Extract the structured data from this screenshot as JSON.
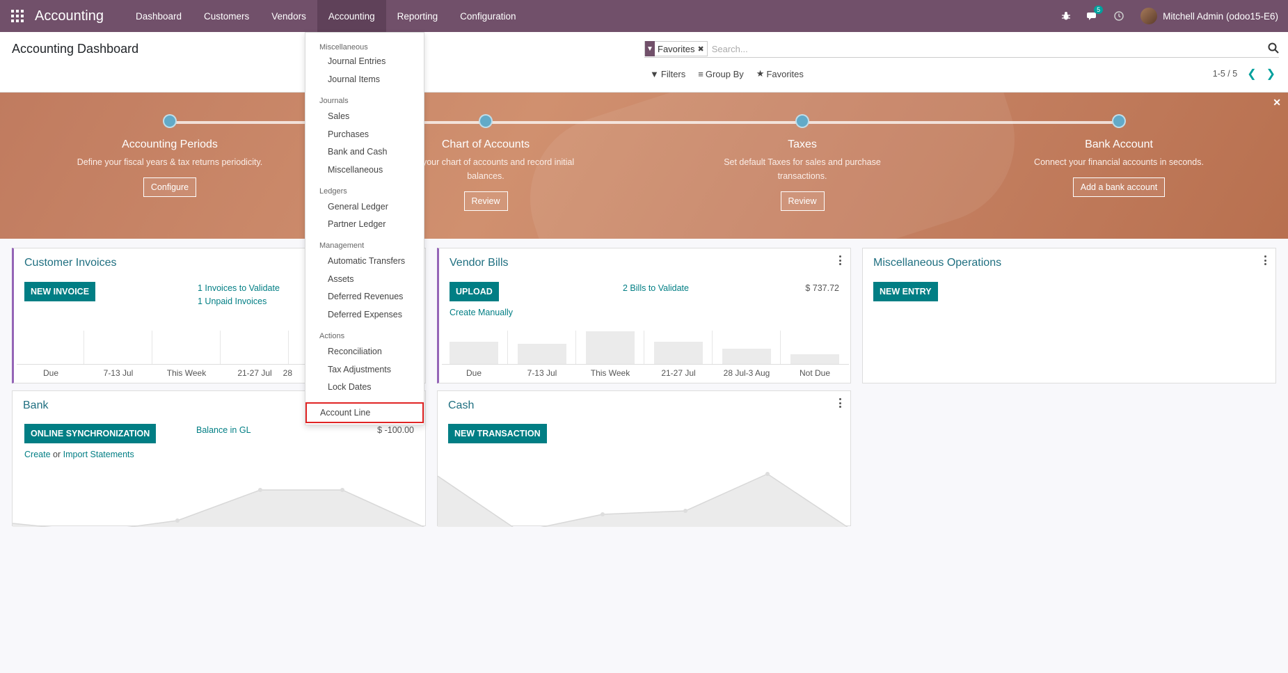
{
  "navbar": {
    "brand": "Accounting",
    "menu": [
      "Dashboard",
      "Customers",
      "Vendors",
      "Accounting",
      "Reporting",
      "Configuration"
    ],
    "messages_count": "5",
    "user": "Mitchell Admin (odoo15-E6)"
  },
  "control_panel": {
    "title": "Accounting Dashboard",
    "facet": "Favorites",
    "search_placeholder": "Search...",
    "filters": "Filters",
    "group_by": "Group By",
    "favorites": "Favorites",
    "pager": "1-5 / 5"
  },
  "banner": {
    "steps": [
      {
        "title": "Accounting Periods",
        "desc": "Define your fiscal years & tax returns periodicity.",
        "button": "Configure"
      },
      {
        "title": "Chart of Accounts",
        "desc": "Setup your chart of accounts and record initial balances.",
        "button": "Review"
      },
      {
        "title": "Taxes",
        "desc": "Set default Taxes for sales and purchase transactions.",
        "button": "Review"
      },
      {
        "title": "Bank Account",
        "desc": "Connect your financial accounts in seconds.",
        "button": "Add a bank account"
      }
    ]
  },
  "cards": {
    "customer_invoices": {
      "title": "Customer Invoices",
      "button": "NEW INVOICE",
      "link1": "1 Invoices to Validate",
      "link2": "1 Unpaid Invoices",
      "axis": [
        "Due",
        "7-13 Jul",
        "This Week",
        "21-27 Jul",
        "28"
      ]
    },
    "vendor_bills": {
      "title": "Vendor Bills",
      "button": "UPLOAD",
      "link1": "2 Bills to Validate",
      "amount": "$ 737.72",
      "link2": "Create Manually",
      "axis": [
        "Due",
        "7-13 Jul",
        "This Week",
        "21-27 Jul",
        "28 Jul-3 Aug",
        "Not Due"
      ]
    },
    "misc_operations": {
      "title": "Miscellaneous Operations",
      "button": "NEW ENTRY"
    },
    "bank": {
      "title": "Bank",
      "button": "ONLINE SYNCHRONIZATION",
      "link1": "Balance in GL",
      "amount": "$ -100.00",
      "create_link": "Create",
      "or_text": "or",
      "import_link": "Import Statements"
    },
    "cash": {
      "title": "Cash",
      "button": "NEW TRANSACTION"
    }
  },
  "dropdown": {
    "sections": [
      {
        "header": "Miscellaneous",
        "items": [
          "Journal Entries",
          "Journal Items"
        ]
      },
      {
        "header": "Journals",
        "items": [
          "Sales",
          "Purchases",
          "Bank and Cash",
          "Miscellaneous"
        ]
      },
      {
        "header": "Ledgers",
        "items": [
          "General Ledger",
          "Partner Ledger"
        ]
      },
      {
        "header": "Management",
        "items": [
          "Automatic Transfers",
          "Assets",
          "Deferred Revenues",
          "Deferred Expenses"
        ]
      },
      {
        "header": "Actions",
        "items": [
          "Reconciliation",
          "Tax Adjustments",
          "Lock Dates"
        ]
      }
    ],
    "highlighted_item": "Account Line"
  }
}
